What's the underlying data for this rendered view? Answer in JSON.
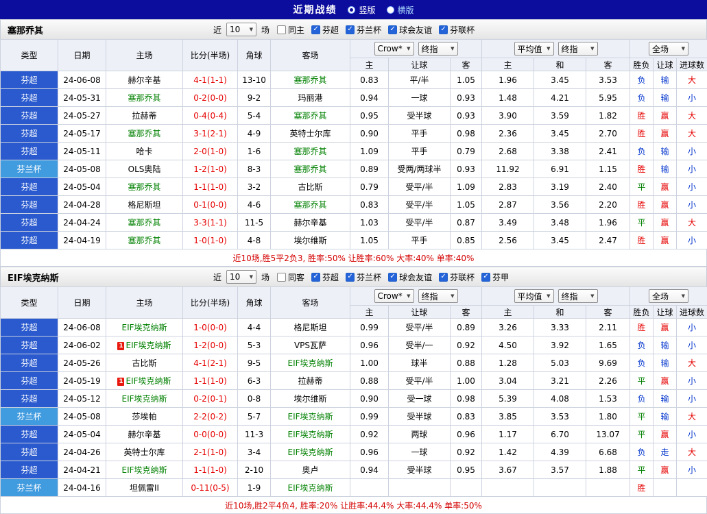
{
  "topbar": {
    "title": "近期战绩",
    "vertical_label": "竖版",
    "horizontal_label": "横版",
    "selected": "竖版"
  },
  "table_header": {
    "left_cols": [
      "类型",
      "日期",
      "主场",
      "比分(半场)",
      "角球",
      "客场"
    ],
    "odds_selects": [
      "Crow*",
      "终指"
    ],
    "avg_selects": [
      "平均值",
      "终指"
    ],
    "scope_select": "全场",
    "odds_sub": [
      "主",
      "让球",
      "客"
    ],
    "avg_sub": [
      "主",
      "和",
      "客"
    ],
    "result_sub": [
      "胜负",
      "让球",
      "进球数"
    ]
  },
  "colors": {
    "topbar_bg": "#0d0d9d",
    "league_super_bg": "#2a5ace",
    "league_cup_bg": "#419bdf",
    "win_red": "#e60000",
    "draw_green": "#008000",
    "lose_blue": "#0033cc",
    "score_red": "#e60000",
    "focus_team_green": "#008000"
  },
  "sections": [
    {
      "team": "塞那乔其",
      "near_label": "近",
      "near_value": "10",
      "games_label": "场",
      "filters": [
        {
          "label": "同主",
          "checked": false
        },
        {
          "label": "芬超",
          "checked": true
        },
        {
          "label": "芬兰杯",
          "checked": true
        },
        {
          "label": "球会友谊",
          "checked": true
        },
        {
          "label": "芬联杯",
          "checked": true
        }
      ],
      "rows": [
        {
          "type": "芬超",
          "type_style": "league-super",
          "date": "24-06-08",
          "home": "赫尔辛基",
          "home_focus": false,
          "home_cards": 0,
          "score": "4-1(1-1)",
          "corner": "13-10",
          "away": "塞那乔其",
          "away_focus": true,
          "away_cards": 0,
          "odds": [
            "0.83",
            "平/半",
            "1.05"
          ],
          "avg": [
            "1.96",
            "3.45",
            "3.53"
          ],
          "result": [
            {
              "t": "负",
              "c": "b"
            },
            {
              "t": "输",
              "c": "b"
            },
            {
              "t": "大",
              "c": "r"
            }
          ]
        },
        {
          "type": "芬超",
          "type_style": "league-super",
          "date": "24-05-31",
          "home": "塞那乔其",
          "home_focus": true,
          "home_cards": 0,
          "score": "0-2(0-0)",
          "corner": "9-2",
          "away": "玛丽港",
          "away_focus": false,
          "away_cards": 0,
          "odds": [
            "0.94",
            "一球",
            "0.93"
          ],
          "avg": [
            "1.48",
            "4.21",
            "5.95"
          ],
          "result": [
            {
              "t": "负",
              "c": "b"
            },
            {
              "t": "输",
              "c": "b"
            },
            {
              "t": "小",
              "c": "b"
            }
          ]
        },
        {
          "type": "芬超",
          "type_style": "league-super",
          "date": "24-05-27",
          "home": "拉赫蒂",
          "home_focus": false,
          "home_cards": 0,
          "score": "0-4(0-4)",
          "corner": "5-4",
          "away": "塞那乔其",
          "away_focus": true,
          "away_cards": 0,
          "odds": [
            "0.95",
            "受半球",
            "0.93"
          ],
          "avg": [
            "3.90",
            "3.59",
            "1.82"
          ],
          "result": [
            {
              "t": "胜",
              "c": "r"
            },
            {
              "t": "赢",
              "c": "r"
            },
            {
              "t": "大",
              "c": "r"
            }
          ]
        },
        {
          "type": "芬超",
          "type_style": "league-super",
          "date": "24-05-17",
          "home": "塞那乔其",
          "home_focus": true,
          "home_cards": 0,
          "score": "3-1(2-1)",
          "corner": "4-9",
          "away": "英特士尔库",
          "away_focus": false,
          "away_cards": 0,
          "odds": [
            "0.90",
            "平手",
            "0.98"
          ],
          "avg": [
            "2.36",
            "3.45",
            "2.70"
          ],
          "result": [
            {
              "t": "胜",
              "c": "r"
            },
            {
              "t": "赢",
              "c": "r"
            },
            {
              "t": "大",
              "c": "r"
            }
          ]
        },
        {
          "type": "芬超",
          "type_style": "league-super",
          "date": "24-05-11",
          "home": "哈卡",
          "home_focus": false,
          "home_cards": 0,
          "score": "2-0(1-0)",
          "corner": "1-6",
          "away": "塞那乔其",
          "away_focus": true,
          "away_cards": 0,
          "odds": [
            "1.09",
            "平手",
            "0.79"
          ],
          "avg": [
            "2.68",
            "3.38",
            "2.41"
          ],
          "result": [
            {
              "t": "负",
              "c": "b"
            },
            {
              "t": "输",
              "c": "b"
            },
            {
              "t": "小",
              "c": "b"
            }
          ]
        },
        {
          "type": "芬兰杯",
          "type_style": "league-cup",
          "date": "24-05-08",
          "home": "OLS奥陆",
          "home_focus": false,
          "home_cards": 0,
          "score": "1-2(1-0)",
          "corner": "8-3",
          "away": "塞那乔其",
          "away_focus": true,
          "away_cards": 0,
          "odds": [
            "0.89",
            "受两/两球半",
            "0.93"
          ],
          "avg": [
            "11.92",
            "6.91",
            "1.15"
          ],
          "result": [
            {
              "t": "胜",
              "c": "r"
            },
            {
              "t": "输",
              "c": "b"
            },
            {
              "t": "小",
              "c": "b"
            }
          ]
        },
        {
          "type": "芬超",
          "type_style": "league-super",
          "date": "24-05-04",
          "home": "塞那乔其",
          "home_focus": true,
          "home_cards": 0,
          "score": "1-1(1-0)",
          "corner": "3-2",
          "away": "古比斯",
          "away_focus": false,
          "away_cards": 0,
          "odds": [
            "0.79",
            "受平/半",
            "1.09"
          ],
          "avg": [
            "2.83",
            "3.19",
            "2.40"
          ],
          "result": [
            {
              "t": "平",
              "c": "g"
            },
            {
              "t": "赢",
              "c": "r"
            },
            {
              "t": "小",
              "c": "b"
            }
          ]
        },
        {
          "type": "芬超",
          "type_style": "league-super",
          "date": "24-04-28",
          "home": "格尼斯坦",
          "home_focus": false,
          "home_cards": 0,
          "score": "0-1(0-0)",
          "corner": "4-6",
          "away": "塞那乔其",
          "away_focus": true,
          "away_cards": 0,
          "odds": [
            "0.83",
            "受平/半",
            "1.05"
          ],
          "avg": [
            "2.87",
            "3.56",
            "2.20"
          ],
          "result": [
            {
              "t": "胜",
              "c": "r"
            },
            {
              "t": "赢",
              "c": "r"
            },
            {
              "t": "小",
              "c": "b"
            }
          ]
        },
        {
          "type": "芬超",
          "type_style": "league-super",
          "date": "24-04-24",
          "home": "塞那乔其",
          "home_focus": true,
          "home_cards": 0,
          "score": "3-3(1-1)",
          "corner": "11-5",
          "away": "赫尔辛基",
          "away_focus": false,
          "away_cards": 0,
          "odds": [
            "1.03",
            "受平/半",
            "0.87"
          ],
          "avg": [
            "3.49",
            "3.48",
            "1.96"
          ],
          "result": [
            {
              "t": "平",
              "c": "g"
            },
            {
              "t": "赢",
              "c": "r"
            },
            {
              "t": "大",
              "c": "r"
            }
          ]
        },
        {
          "type": "芬超",
          "type_style": "league-super",
          "date": "24-04-19",
          "home": "塞那乔其",
          "home_focus": true,
          "home_cards": 0,
          "score": "1-0(1-0)",
          "corner": "4-8",
          "away": "埃尔维斯",
          "away_focus": false,
          "away_cards": 0,
          "odds": [
            "1.05",
            "平手",
            "0.85"
          ],
          "avg": [
            "2.56",
            "3.45",
            "2.47"
          ],
          "result": [
            {
              "t": "胜",
              "c": "r"
            },
            {
              "t": "赢",
              "c": "r"
            },
            {
              "t": "小",
              "c": "b"
            }
          ]
        }
      ],
      "summary": "近10场,胜5平2负3, 胜率:50% 让胜率:60% 大率:40% 单率:40%"
    },
    {
      "team": "EIF埃克纳斯",
      "near_label": "近",
      "near_value": "10",
      "games_label": "场",
      "filters": [
        {
          "label": "同客",
          "checked": false
        },
        {
          "label": "芬超",
          "checked": true
        },
        {
          "label": "芬兰杯",
          "checked": true
        },
        {
          "label": "球会友谊",
          "checked": true
        },
        {
          "label": "芬联杯",
          "checked": true
        },
        {
          "label": "芬甲",
          "checked": true
        }
      ],
      "rows": [
        {
          "type": "芬超",
          "type_style": "league-super",
          "date": "24-06-08",
          "home": "EIF埃克纳斯",
          "home_focus": true,
          "home_cards": 0,
          "score": "1-0(0-0)",
          "corner": "4-4",
          "away": "格尼斯坦",
          "away_focus": false,
          "away_cards": 0,
          "odds": [
            "0.99",
            "受平/半",
            "0.89"
          ],
          "avg": [
            "3.26",
            "3.33",
            "2.11"
          ],
          "result": [
            {
              "t": "胜",
              "c": "r"
            },
            {
              "t": "赢",
              "c": "r"
            },
            {
              "t": "小",
              "c": "b"
            }
          ]
        },
        {
          "type": "芬超",
          "type_style": "league-super",
          "date": "24-06-02",
          "home": "EIF埃克纳斯",
          "home_focus": true,
          "home_cards": 1,
          "score": "1-2(0-0)",
          "corner": "5-3",
          "away": "VPS瓦萨",
          "away_focus": false,
          "away_cards": 0,
          "odds": [
            "0.96",
            "受半/一",
            "0.92"
          ],
          "avg": [
            "4.50",
            "3.92",
            "1.65"
          ],
          "result": [
            {
              "t": "负",
              "c": "b"
            },
            {
              "t": "输",
              "c": "b"
            },
            {
              "t": "小",
              "c": "b"
            }
          ]
        },
        {
          "type": "芬超",
          "type_style": "league-super",
          "date": "24-05-26",
          "home": "古比斯",
          "home_focus": false,
          "home_cards": 0,
          "score": "4-1(2-1)",
          "corner": "9-5",
          "away": "EIF埃克纳斯",
          "away_focus": true,
          "away_cards": 0,
          "odds": [
            "1.00",
            "球半",
            "0.88"
          ],
          "avg": [
            "1.28",
            "5.03",
            "9.69"
          ],
          "result": [
            {
              "t": "负",
              "c": "b"
            },
            {
              "t": "输",
              "c": "b"
            },
            {
              "t": "大",
              "c": "r"
            }
          ]
        },
        {
          "type": "芬超",
          "type_style": "league-super",
          "date": "24-05-19",
          "home": "EIF埃克纳斯",
          "home_focus": true,
          "home_cards": 1,
          "score": "1-1(1-0)",
          "corner": "6-3",
          "away": "拉赫蒂",
          "away_focus": false,
          "away_cards": 0,
          "odds": [
            "0.88",
            "受平/半",
            "1.00"
          ],
          "avg": [
            "3.04",
            "3.21",
            "2.26"
          ],
          "result": [
            {
              "t": "平",
              "c": "g"
            },
            {
              "t": "赢",
              "c": "r"
            },
            {
              "t": "小",
              "c": "b"
            }
          ]
        },
        {
          "type": "芬超",
          "type_style": "league-super",
          "date": "24-05-12",
          "home": "EIF埃克纳斯",
          "home_focus": true,
          "home_cards": 0,
          "score": "0-2(0-1)",
          "corner": "0-8",
          "away": "埃尔维斯",
          "away_focus": false,
          "away_cards": 0,
          "odds": [
            "0.90",
            "受一球",
            "0.98"
          ],
          "avg": [
            "5.39",
            "4.08",
            "1.53"
          ],
          "result": [
            {
              "t": "负",
              "c": "b"
            },
            {
              "t": "输",
              "c": "b"
            },
            {
              "t": "小",
              "c": "b"
            }
          ]
        },
        {
          "type": "芬兰杯",
          "type_style": "league-cup",
          "date": "24-05-08",
          "home": "莎埃帕",
          "home_focus": false,
          "home_cards": 0,
          "score": "2-2(0-2)",
          "corner": "5-7",
          "away": "EIF埃克纳斯",
          "away_focus": true,
          "away_cards": 0,
          "odds": [
            "0.99",
            "受半球",
            "0.83"
          ],
          "avg": [
            "3.85",
            "3.53",
            "1.80"
          ],
          "result": [
            {
              "t": "平",
              "c": "g"
            },
            {
              "t": "输",
              "c": "b"
            },
            {
              "t": "大",
              "c": "r"
            }
          ]
        },
        {
          "type": "芬超",
          "type_style": "league-super",
          "date": "24-05-04",
          "home": "赫尔辛基",
          "home_focus": false,
          "home_cards": 0,
          "score": "0-0(0-0)",
          "corner": "11-3",
          "away": "EIF埃克纳斯",
          "away_focus": true,
          "away_cards": 0,
          "odds": [
            "0.92",
            "两球",
            "0.96"
          ],
          "avg": [
            "1.17",
            "6.70",
            "13.07"
          ],
          "result": [
            {
              "t": "平",
              "c": "g"
            },
            {
              "t": "赢",
              "c": "r"
            },
            {
              "t": "小",
              "c": "b"
            }
          ]
        },
        {
          "type": "芬超",
          "type_style": "league-super",
          "date": "24-04-26",
          "home": "英特士尔库",
          "home_focus": false,
          "home_cards": 0,
          "score": "2-1(1-0)",
          "corner": "3-4",
          "away": "EIF埃克纳斯",
          "away_focus": true,
          "away_cards": 0,
          "odds": [
            "0.96",
            "一球",
            "0.92"
          ],
          "avg": [
            "1.42",
            "4.39",
            "6.68"
          ],
          "result": [
            {
              "t": "负",
              "c": "b"
            },
            {
              "t": "走",
              "c": "b"
            },
            {
              "t": "大",
              "c": "r"
            }
          ]
        },
        {
          "type": "芬超",
          "type_style": "league-super",
          "date": "24-04-21",
          "home": "EIF埃克纳斯",
          "home_focus": true,
          "home_cards": 0,
          "score": "1-1(1-0)",
          "corner": "2-10",
          "away": "奥卢",
          "away_focus": false,
          "away_cards": 0,
          "odds": [
            "0.94",
            "受半球",
            "0.95"
          ],
          "avg": [
            "3.67",
            "3.57",
            "1.88"
          ],
          "result": [
            {
              "t": "平",
              "c": "g"
            },
            {
              "t": "赢",
              "c": "r"
            },
            {
              "t": "小",
              "c": "b"
            }
          ]
        },
        {
          "type": "芬兰杯",
          "type_style": "league-cup",
          "date": "24-04-16",
          "home": "坦佩雷II",
          "home_focus": false,
          "home_cards": 0,
          "score": "0-11(0-5)",
          "corner": "1-9",
          "away": "EIF埃克纳斯",
          "away_focus": true,
          "away_cards": 0,
          "odds": [
            "",
            "",
            ""
          ],
          "avg": [
            "",
            "",
            ""
          ],
          "result": [
            {
              "t": "胜",
              "c": "r"
            },
            {
              "t": "",
              "c": ""
            },
            {
              "t": "",
              "c": ""
            }
          ]
        }
      ],
      "summary": "近10场,胜2平4负4, 胜率:20% 让胜率:44.4% 大率:44.4% 单率:50%"
    }
  ]
}
